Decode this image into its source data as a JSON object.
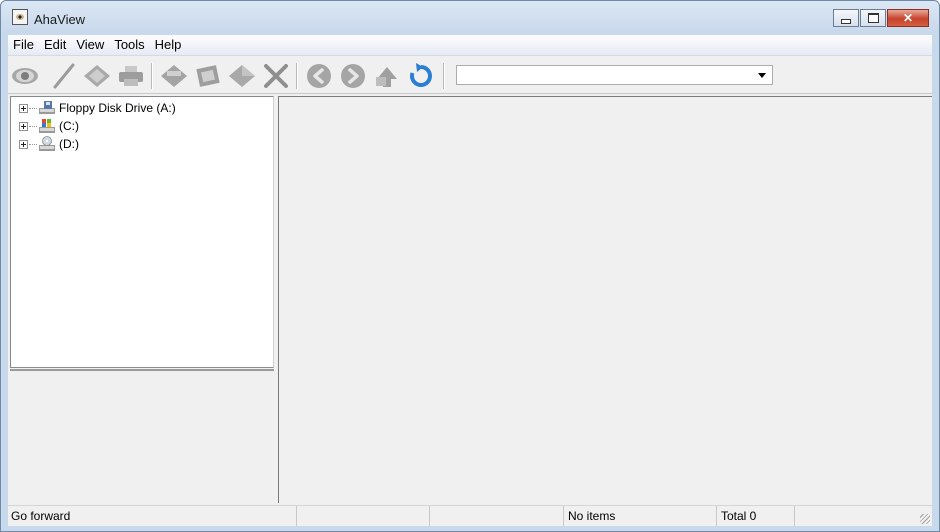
{
  "window": {
    "title": "AhaView",
    "app_icon": "eye-app-icon"
  },
  "menu": [
    {
      "label": "File"
    },
    {
      "label": "Edit"
    },
    {
      "label": "View"
    },
    {
      "label": "Tools"
    },
    {
      "label": "Help"
    }
  ],
  "toolbar": {
    "buttons": [
      {
        "icon": "eye-view-icon"
      },
      {
        "icon": "pen-edit-icon"
      },
      {
        "icon": "diamond-tag-icon"
      },
      {
        "icon": "printer-icon"
      },
      {
        "icon": "rename-icon"
      },
      {
        "icon": "film-slideshow-icon"
      },
      {
        "icon": "diamond-convert-icon"
      },
      {
        "icon": "delete-x-icon"
      },
      {
        "icon": "back-arrow-icon"
      },
      {
        "icon": "forward-arrow-icon"
      },
      {
        "icon": "up-folder-icon"
      },
      {
        "icon": "refresh-icon"
      }
    ],
    "address_value": ""
  },
  "tree": {
    "items": [
      {
        "label": "Floppy Disk Drive (A:)",
        "icon": "floppy-drive-icon"
      },
      {
        "label": "(C:)",
        "icon": "windows-drive-icon"
      },
      {
        "label": "(D:)",
        "icon": "optical-drive-icon"
      }
    ]
  },
  "status": {
    "message": "Go forward",
    "cell2": "",
    "cell3": "",
    "items": "No items",
    "total": "Total 0",
    "cell6": ""
  },
  "colors": {
    "toolbar_icon_gray": "#a3a3a3",
    "refresh_blue": "#2a7fd4",
    "close_red": "#c7422d"
  }
}
